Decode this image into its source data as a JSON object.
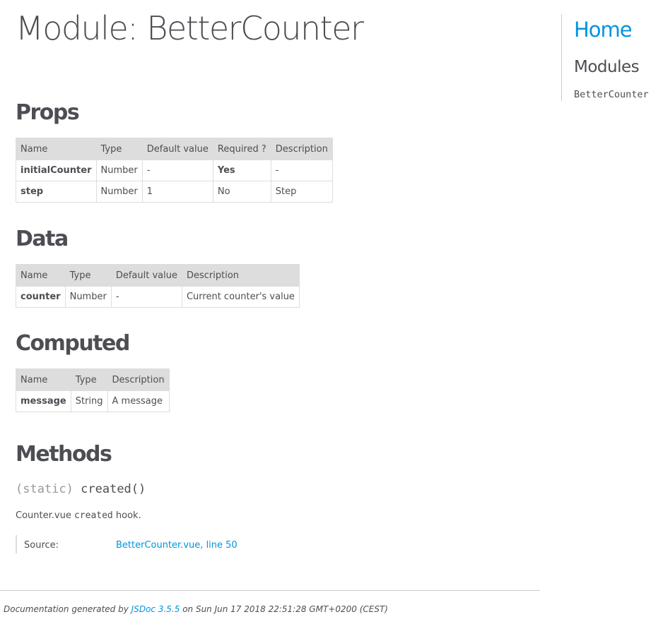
{
  "page": {
    "title": "Module: BetterCounter"
  },
  "sections": {
    "props": {
      "title": "Props",
      "headers": [
        "Name",
        "Type",
        "Default value",
        "Required ?",
        "Description"
      ],
      "rows": [
        [
          "initialCounter",
          "Number",
          "-",
          "Yes",
          "-"
        ],
        [
          "step",
          "Number",
          "1",
          "No",
          "Step"
        ]
      ]
    },
    "data": {
      "title": "Data",
      "headers": [
        "Name",
        "Type",
        "Default value",
        "Description"
      ],
      "rows": [
        [
          "counter",
          "Number",
          "-",
          "Current counter's value"
        ]
      ]
    },
    "computed": {
      "title": "Computed",
      "headers": [
        "Name",
        "Type",
        "Description"
      ],
      "rows": [
        [
          "message",
          "String",
          "A message"
        ]
      ]
    },
    "methods": {
      "title": "Methods",
      "attribs": "(static)",
      "name": "created()",
      "desc_prefix": "Counter.vue",
      "desc_code": "created",
      "desc_suffix": "hook.",
      "source_label": "Source:",
      "source_file": "BetterCounter.vue",
      "source_sep": ",",
      "source_line": "line 50"
    }
  },
  "nav": {
    "home": "Home",
    "modules_heading": "Modules",
    "modules": [
      "BetterCounter"
    ]
  },
  "footer": {
    "prefix": "Documentation generated by",
    "generator": "JSDoc 3.5.5",
    "suffix": "on Sun Jun 17 2018 22:51:28 GMT+0200 (CEST)"
  },
  "colors": {
    "link": "#0095dd",
    "text": "#4d4e53",
    "table_header_bg": "#dddddd"
  }
}
